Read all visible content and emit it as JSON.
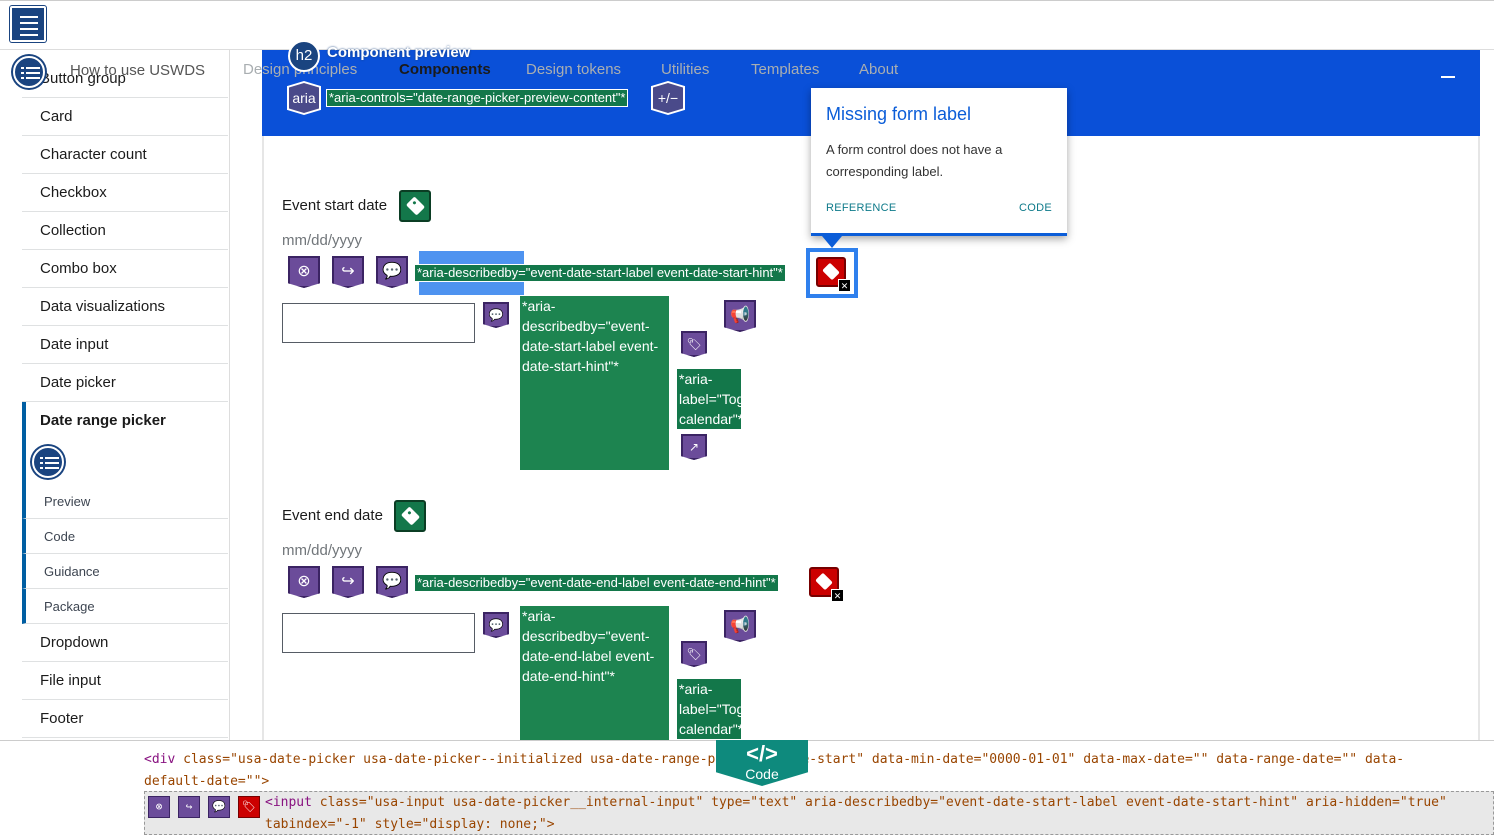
{
  "header": {
    "logo_icon": "document-list-icon"
  },
  "sidebar": {
    "items_top": [
      "Button group",
      "Card",
      "Character count",
      "Checkbox",
      "Collection",
      "Combo box",
      "Data visualizations",
      "Date input",
      "Date picker",
      "Date range picker"
    ],
    "sub_items": [
      "Preview",
      "Code",
      "Guidance",
      "Package"
    ],
    "items_bottom": [
      "Dropdown",
      "File input",
      "Footer"
    ],
    "overlay_text": "How to use USWDS"
  },
  "nav": {
    "items": [
      "Design principles",
      "Components",
      "Design tokens",
      "Utilities",
      "Templates",
      "About"
    ],
    "active": "Components"
  },
  "preview": {
    "h2_badge": "h2",
    "h2_text": "Component preview",
    "aria_badge": "aria",
    "aria_controls": "*aria-controls=\"date-range-picker-preview-content\"*",
    "toggle_badge": "+/−"
  },
  "start": {
    "label": "Event start date",
    "hint": "mm/dd/yyyy",
    "aria_describedby": "*aria-describedby=\"event-date-start-label event-date-start-hint\"*",
    "green_block": "*aria-describedby=\"event-date-start-label event-date-start-hint\"*",
    "aria_label": "*aria-label=\"Toggle calendar\"*"
  },
  "end": {
    "label": "Event end date",
    "hint": "mm/dd/yyyy",
    "aria_describedby": "*aria-describedby=\"event-date-end-label event-date-end-hint\"*",
    "green_block": "*aria-describedby=\"event-date-end-label event-date-end-hint\"*",
    "aria_label": "*aria-label=\"Toggle calendar\"*"
  },
  "popup": {
    "title": "Missing form label",
    "body": "A form control does not have a corresponding label.",
    "reference": "REFERENCE",
    "code": "CODE"
  },
  "codebar": {
    "badge_symbol": "</>",
    "badge_label": "Code",
    "line1_tag": "<div",
    "line1_rest": " class=\"usa-date-picker usa-date-picker--initialized usa-date-range-picker__range-start\" data-min-date=\"0000-01-01\" data-max-date=\"\" data-range-date=\"\" data-default-date=\"\">",
    "line2_tag": "<input",
    "line2_rest": " class=\"usa-input usa-date-picker__internal-input\" type=\"text\" aria-describedby=\"event-date-start-label event-date-start-hint\" aria-hidden=\"true\" tabindex=\"-1\" style=\"display: none;\">"
  },
  "colors": {
    "blue_bar": "#0a50d8",
    "green_annot": "#13774a",
    "purple_icon": "#6b4c9a",
    "error_red": "#cc0000",
    "popup_blue": "#0b5dd8"
  }
}
